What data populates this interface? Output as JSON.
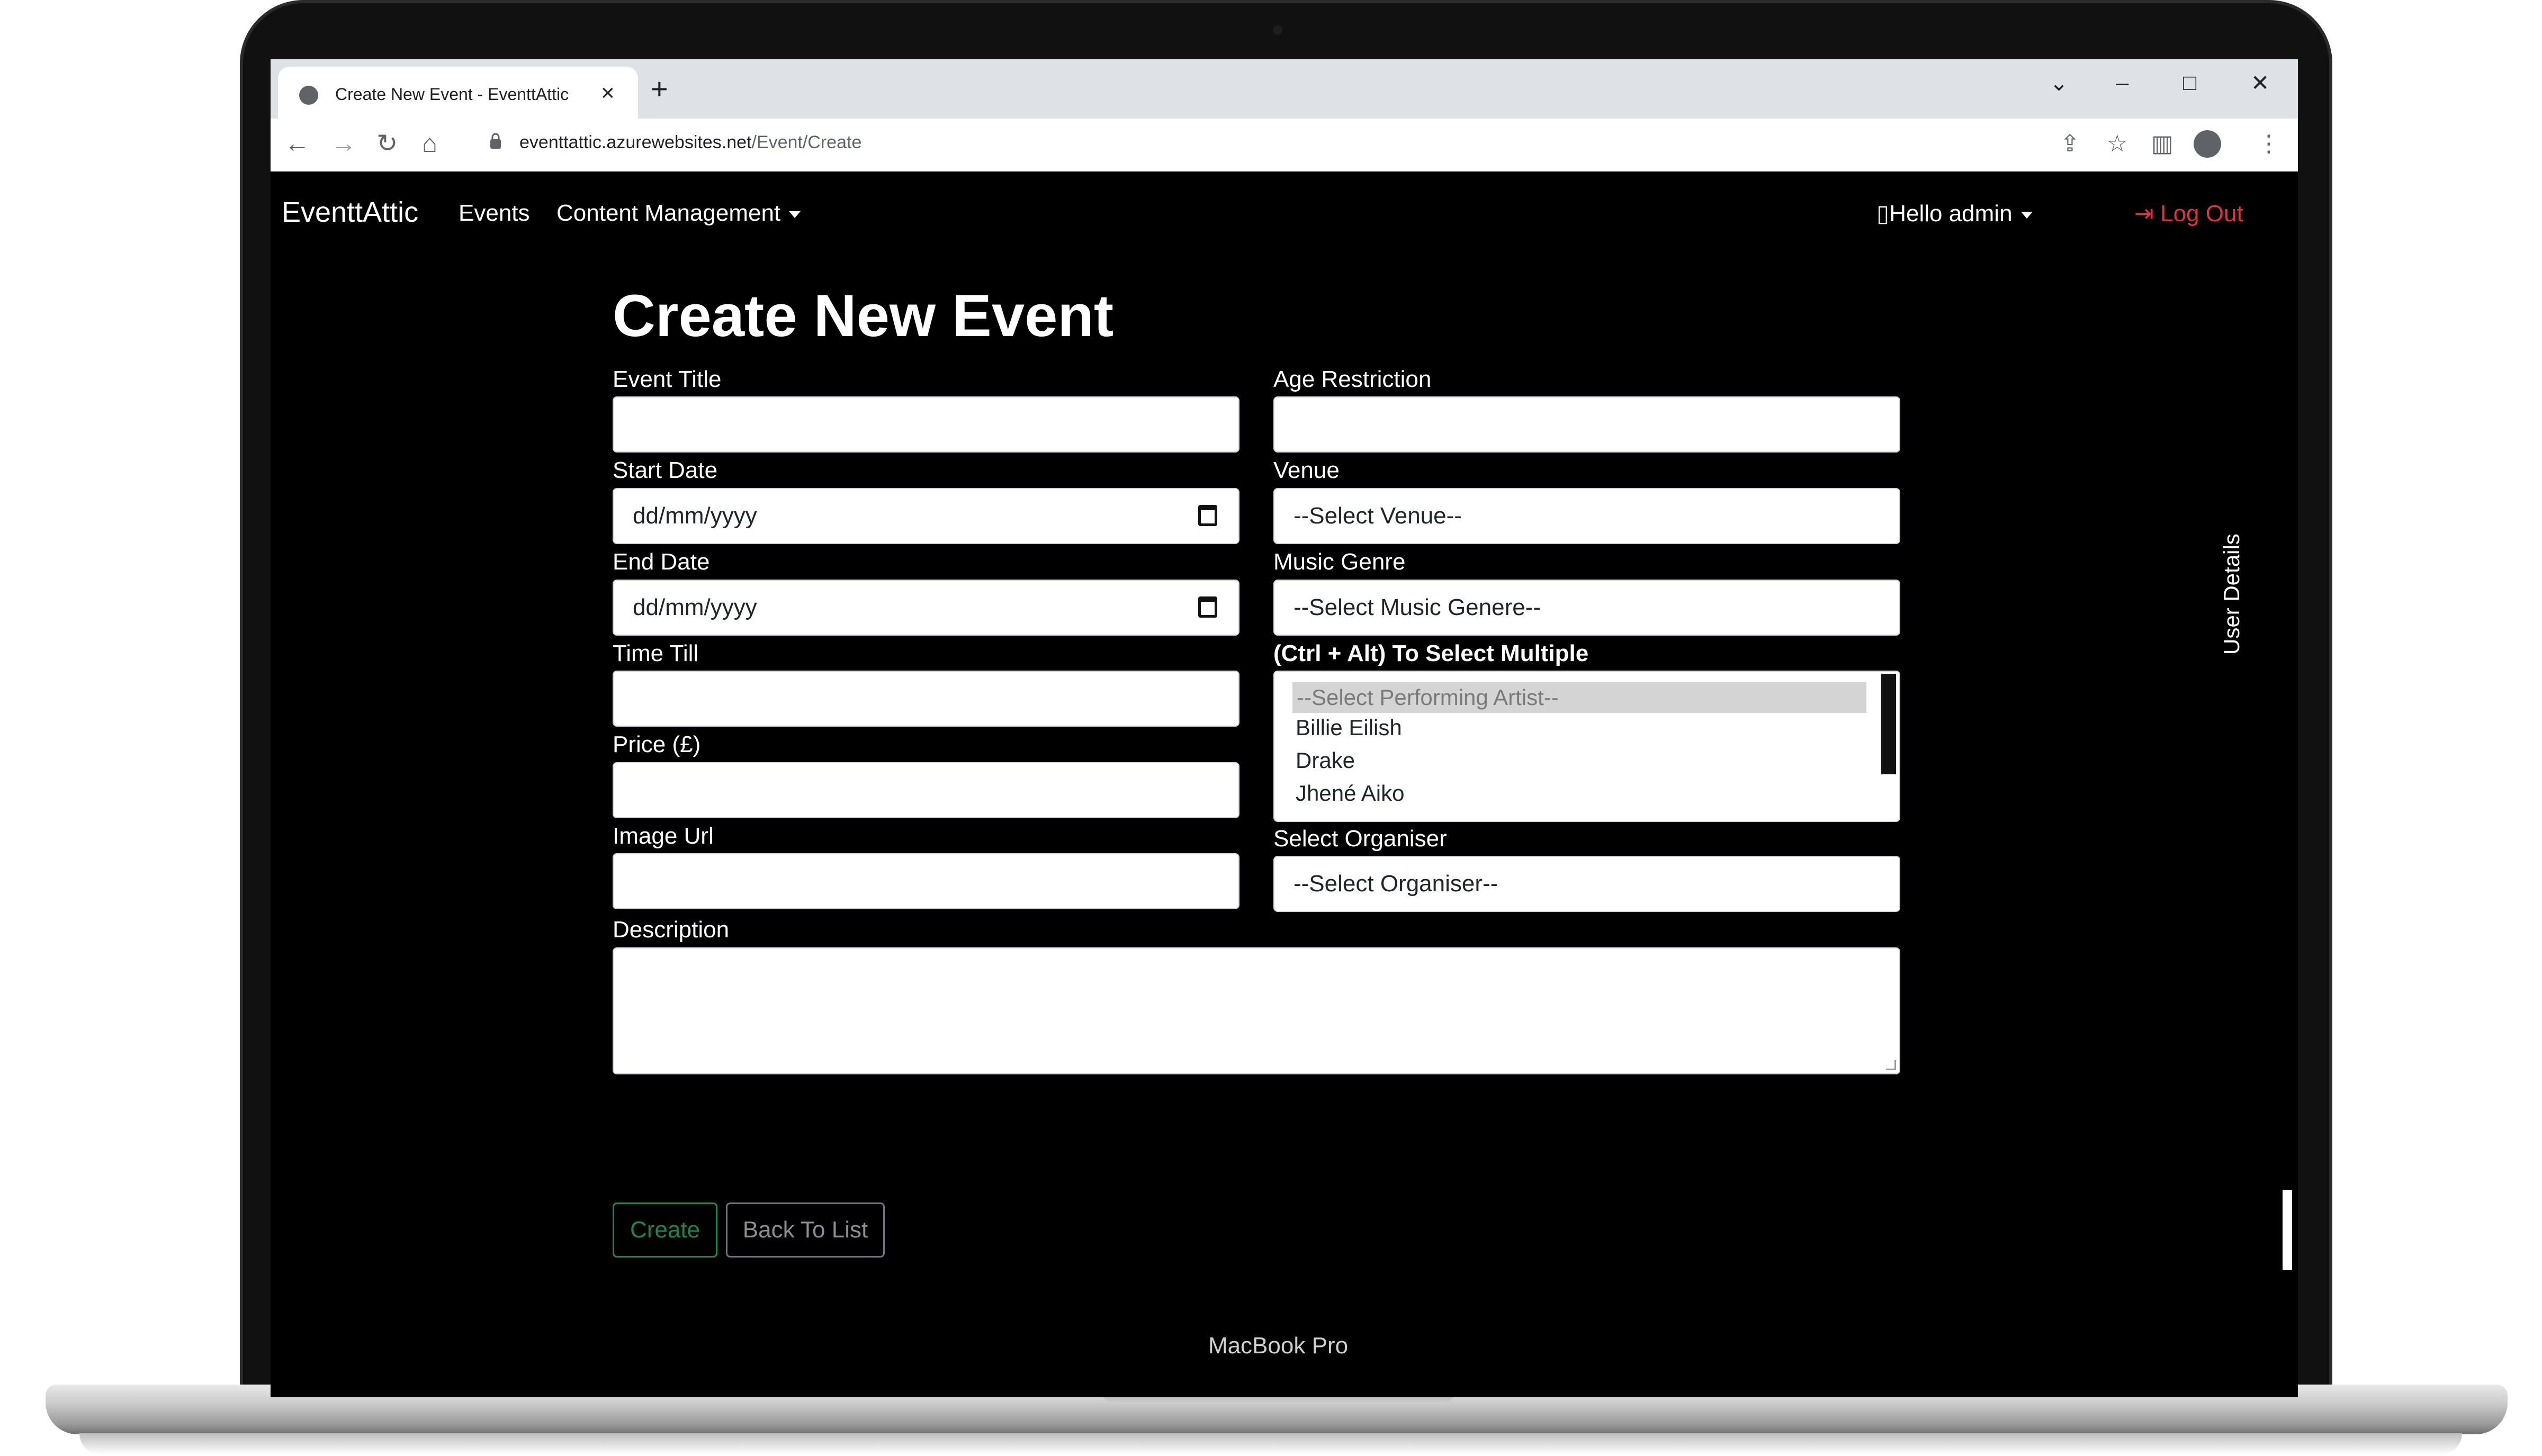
{
  "device": {
    "label": "MacBook Pro"
  },
  "browser": {
    "tab_title": "Create New Event - EventtAttic",
    "url_host": "eventtattic.azurewebsites.net",
    "url_path": "/Event/Create"
  },
  "navbar": {
    "brand": "EventtAttic",
    "links": [
      "Events",
      "Content Management"
    ],
    "user_greeting": "Hello admin",
    "logout": "Log Out"
  },
  "form": {
    "heading": "Create New Event",
    "left": {
      "event_title": {
        "label": "Event Title",
        "value": ""
      },
      "start_date": {
        "label": "Start Date",
        "placeholder": "dd/mm/yyyy"
      },
      "end_date": {
        "label": "End Date",
        "placeholder": "dd/mm/yyyy"
      },
      "time_till": {
        "label": "Time Till",
        "value": ""
      },
      "price": {
        "label": "Price (£)",
        "value": ""
      },
      "image_url": {
        "label": "Image Url",
        "value": ""
      }
    },
    "right": {
      "age_restriction": {
        "label": "Age Restriction",
        "value": ""
      },
      "venue": {
        "label": "Venue",
        "selected": "--Select Venue--"
      },
      "music_genre": {
        "label": "Music Genre",
        "selected": "--Select Music Genere--"
      },
      "artists": {
        "label": "(Ctrl + Alt) To Select Multiple",
        "options": [
          "--Select Performing Artist--",
          "Billie Eilish",
          "Drake",
          "Jhené Aiko"
        ]
      },
      "organiser": {
        "label": "Select Organiser",
        "selected": "--Select Organiser--"
      }
    },
    "description": {
      "label": "Description",
      "value": ""
    },
    "buttons": {
      "create": "Create",
      "back": "Back To List"
    }
  },
  "side_panel": {
    "label": "User Details"
  },
  "colors": {
    "create": "#198754",
    "logout": "#e0333e",
    "background": "#000000"
  }
}
